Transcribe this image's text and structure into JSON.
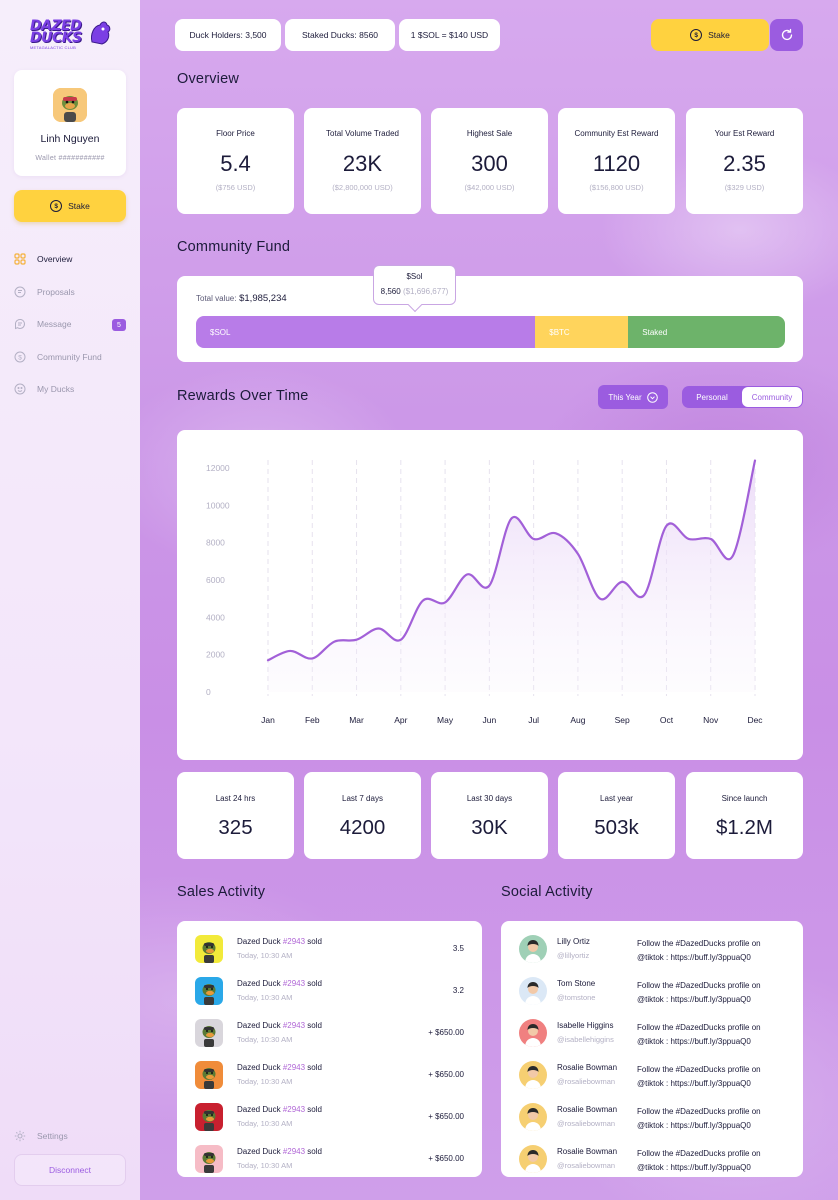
{
  "brand": {
    "logo_line1": "DAZED",
    "logo_line2": "DUCKS",
    "logo_sub": "METAGALACTIC CLUB"
  },
  "profile": {
    "name": "Linh Nguyen",
    "wallet": "Wallet ###########"
  },
  "sidebar": {
    "stake_label": "Stake",
    "items": [
      {
        "label": "Overview",
        "icon": "grid-icon",
        "active": true
      },
      {
        "label": "Proposals",
        "icon": "document-icon"
      },
      {
        "label": "Message",
        "icon": "message-icon",
        "badge": "5"
      },
      {
        "label": "Community Fund",
        "icon": "dollar-icon"
      },
      {
        "label": "My Ducks",
        "icon": "duck-icon"
      }
    ],
    "settings_label": "Settings",
    "disconnect_label": "Disconnect"
  },
  "header": {
    "holders": "Duck Holders: 3,500",
    "staked": "Staked Ducks: 8560",
    "rate": "1 $SOL = $140 USD",
    "stake_label": "Stake"
  },
  "overview": {
    "title": "Overview",
    "stats": [
      {
        "label": "Floor Price",
        "value": "5.4",
        "sub": "($756 USD)"
      },
      {
        "label": "Total Volume Traded",
        "value": "23K",
        "sub": "($2,800,000 USD)"
      },
      {
        "label": "Highest Sale",
        "value": "300",
        "sub": "($42,000 USD)"
      },
      {
        "label": "Community Est Reward",
        "value": "1120",
        "sub": "($156,800 USD)"
      },
      {
        "label": "Your Est Reward",
        "value": "2.35",
        "sub": "($329 USD)"
      }
    ]
  },
  "fund": {
    "title": "Community Fund",
    "total_label": "Total value:",
    "total_value": "$1,985,234",
    "segments": [
      {
        "label": "$SOL",
        "share": 0.576,
        "color": "#b87ce8"
      },
      {
        "label": "$BTC",
        "share": 0.158,
        "color": "#ffd45c"
      },
      {
        "label": "Staked",
        "share": 0.266,
        "color": "#6db36a"
      }
    ],
    "tooltip_title": "$Sol",
    "tooltip_value": "8,560",
    "tooltip_usd": "($1,696,677)"
  },
  "rewards": {
    "title": "Rewards Over Time",
    "period_select": "This Year",
    "toggle": [
      "Personal",
      "Community"
    ],
    "toggle_selected": "Community"
  },
  "chart_data": {
    "type": "line",
    "x": [
      "Jan",
      "Feb",
      "Mar",
      "Apr",
      "May",
      "Jun",
      "Jul",
      "Aug",
      "Sep",
      "Oct",
      "Nov",
      "Dec"
    ],
    "y_ticks": [
      0,
      2000,
      4000,
      6000,
      8000,
      10000,
      12000
    ],
    "ylim": [
      0,
      12000
    ],
    "grid": "vertical dashed",
    "series": [
      {
        "points": [
          [
            0,
            1700
          ],
          [
            0.5,
            2200
          ],
          [
            1,
            1800
          ],
          [
            1.5,
            2700
          ],
          [
            2,
            2800
          ],
          [
            2.5,
            3400
          ],
          [
            3,
            2800
          ],
          [
            3.5,
            4900
          ],
          [
            4,
            4800
          ],
          [
            4.5,
            6300
          ],
          [
            5,
            5700
          ],
          [
            5.5,
            9300
          ],
          [
            6,
            8200
          ],
          [
            6.5,
            8500
          ],
          [
            7,
            7400
          ],
          [
            7.5,
            5000
          ],
          [
            8,
            5900
          ],
          [
            8.5,
            5200
          ],
          [
            9,
            8900
          ],
          [
            9.5,
            8200
          ],
          [
            10,
            8200
          ],
          [
            10.5,
            7300
          ],
          [
            11,
            12400
          ]
        ],
        "color": "#a260d8"
      }
    ]
  },
  "periods": [
    {
      "label": "Last 24 hrs",
      "value": "325"
    },
    {
      "label": "Last 7 days",
      "value": "4200"
    },
    {
      "label": "Last 30 days",
      "value": "30K"
    },
    {
      "label": "Last year",
      "value": "503k"
    },
    {
      "label": "Since launch",
      "value": "$1.2M"
    }
  ],
  "sales": {
    "title": "Sales Activity",
    "items": [
      {
        "name": "Dazed Duck",
        "id": "#2943",
        "verb": "sold",
        "time": "Today, 10:30 AM",
        "amount": "3.5",
        "bg": "#f2ea3a"
      },
      {
        "name": "Dazed Duck",
        "id": "#2943",
        "verb": "sold",
        "time": "Today, 10:30 AM",
        "amount": "3.2",
        "bg": "#2aa8e8"
      },
      {
        "name": "Dazed Duck",
        "id": "#2943",
        "verb": "sold",
        "time": "Today, 10:30 AM",
        "amount": "+ $650.00",
        "bg": "#d9d6dc"
      },
      {
        "name": "Dazed Duck",
        "id": "#2943",
        "verb": "sold",
        "time": "Today, 10:30 AM",
        "amount": "+ $650.00",
        "bg": "#f08c3a"
      },
      {
        "name": "Dazed Duck",
        "id": "#2943",
        "verb": "sold",
        "time": "Today, 10:30 AM",
        "amount": "+ $650.00",
        "bg": "#c8202f"
      },
      {
        "name": "Dazed Duck",
        "id": "#2943",
        "verb": "sold",
        "time": "Today, 10:30 AM",
        "amount": "+ $650.00",
        "bg": "#f6bcc6"
      }
    ]
  },
  "social": {
    "title": "Social Activity",
    "items": [
      {
        "name": "Lilly Ortiz",
        "handle": "@lillyortiz",
        "line1": "Follow the #DazedDucks profile on",
        "line2": "@tiktok : https://buff.ly/3ppuaQ0",
        "bg": "#9fd0b6"
      },
      {
        "name": "Tom Stone",
        "handle": "@tomstone",
        "line1": "Follow the #DazedDucks profile on",
        "line2": "@tiktok : https://buff.ly/3ppuaQ0",
        "bg": "#dbe8f6"
      },
      {
        "name": "Isabelle Higgins",
        "handle": "@isabellehiggins",
        "line1": "Follow the #DazedDucks profile on",
        "line2": "@tiktok : https://buff.ly/3ppuaQ0",
        "bg": "#f08080"
      },
      {
        "name": "Rosalie Bowman",
        "handle": "@rosaliebowman",
        "line1": "Follow the #DazedDucks profile on",
        "line2": "@tiktok : https://buff.ly/3ppuaQ0",
        "bg": "#f6cf72"
      },
      {
        "name": "Rosalie Bowman",
        "handle": "@rosaliebowman",
        "line1": "Follow the #DazedDucks profile on",
        "line2": "@tiktok : https://buff.ly/3ppuaQ0",
        "bg": "#f6cf72"
      },
      {
        "name": "Rosalie Bowman",
        "handle": "@rosaliebowman",
        "line1": "Follow the #DazedDucks profile on",
        "line2": "@tiktok : https://buff.ly/3ppuaQ0",
        "bg": "#f6cf72"
      }
    ]
  }
}
